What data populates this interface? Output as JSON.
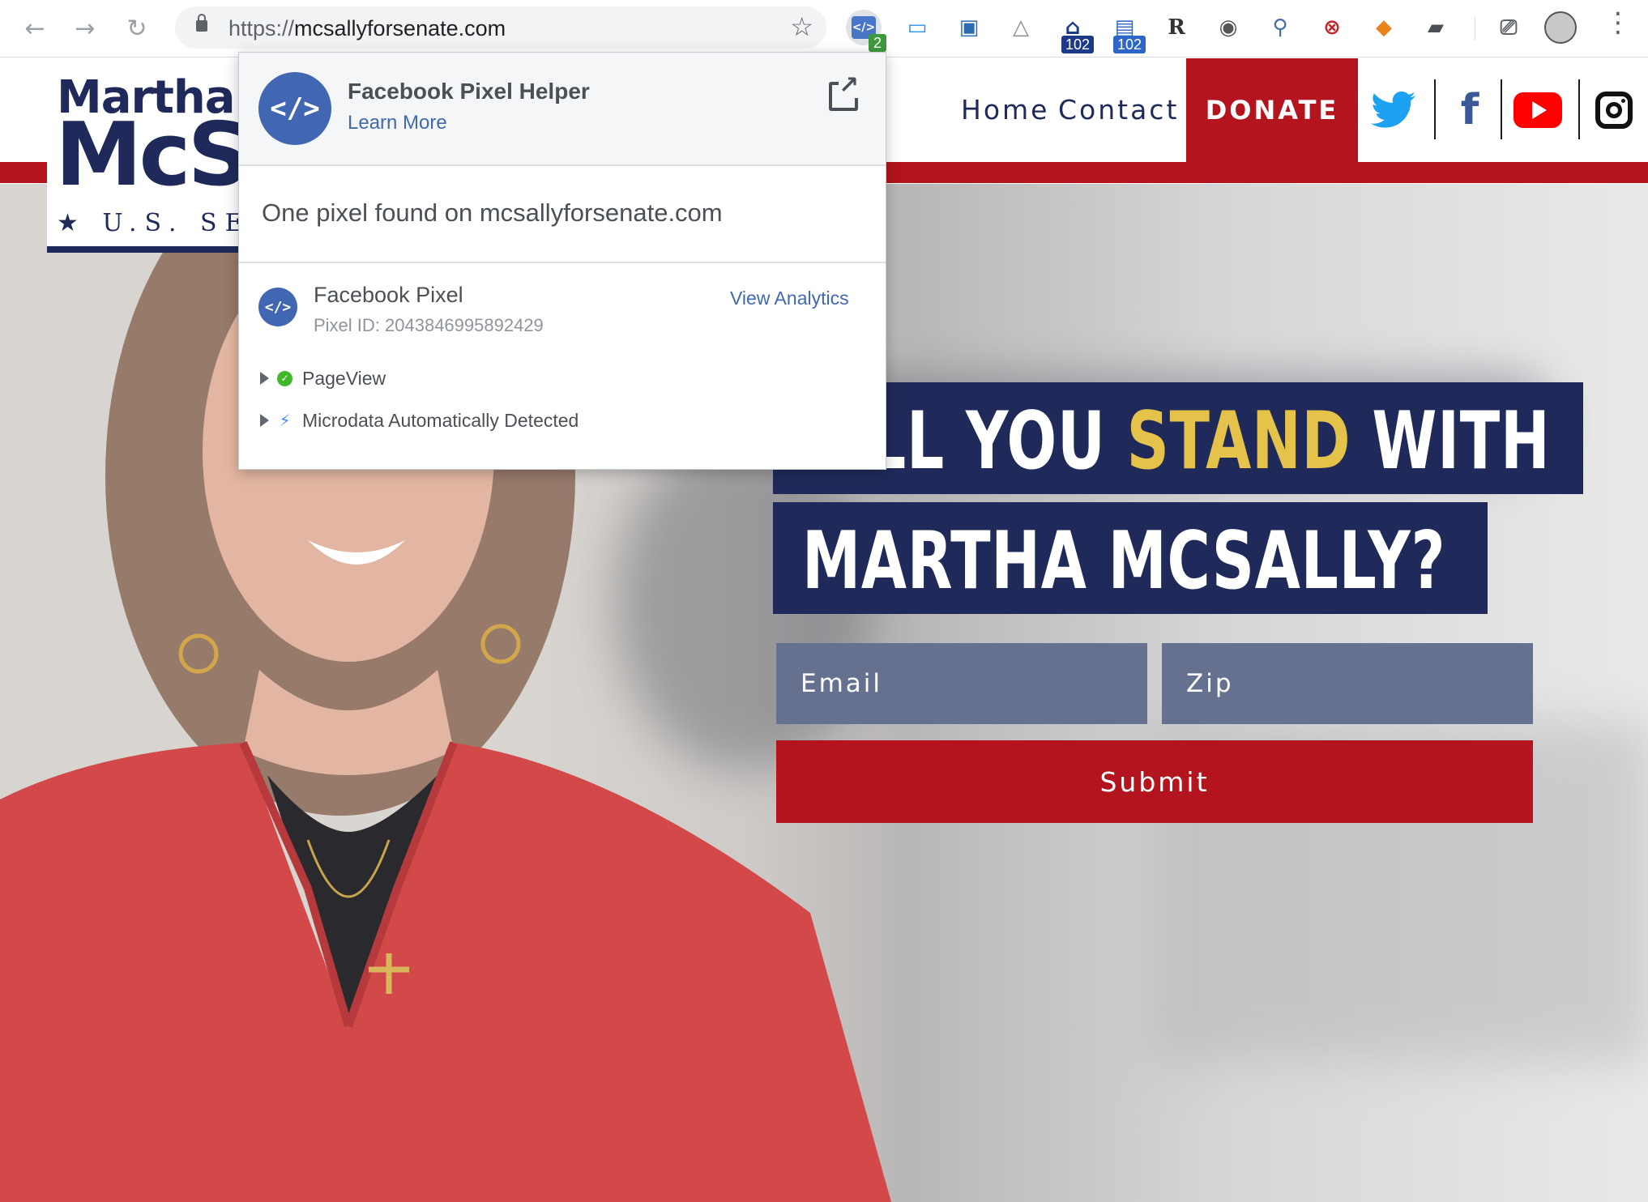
{
  "browser": {
    "url_scheme": "https://",
    "url_host": "mcsallyforsenate.com",
    "extensions": {
      "pixel_helper_badge": "2",
      "badge_a": "102",
      "badge_b": "102",
      "r_label": "R"
    }
  },
  "site": {
    "logo": {
      "first_name": "Martha",
      "last_name_visible": "McSA",
      "subtitle_visible": "★ U.S. SE"
    },
    "nav": {
      "home": "Home",
      "contact": "Contact",
      "donate": "DONATE"
    },
    "headline": {
      "line1_start": "LL YOU ",
      "line1_highlight": "STAND",
      "line1_end": " WITH",
      "line2": "MARTHA MCSALLY?"
    },
    "form": {
      "email_placeholder": "Email",
      "zip_placeholder": "Zip",
      "submit_label": "Submit"
    },
    "colors": {
      "navy": "#1f2a5a",
      "red": "#b3141d",
      "gold": "#e5c24a"
    }
  },
  "popup": {
    "title": "Facebook Pixel Helper",
    "learn_more": "Learn More",
    "found_text": "One pixel found on mcsallyforsenate.com",
    "pixel": {
      "name": "Facebook Pixel",
      "id_text": "Pixel ID: 2043846995892429",
      "view_analytics": "View Analytics"
    },
    "events": [
      {
        "label": "PageView",
        "status": "success"
      },
      {
        "label": "Microdata Automatically Detected",
        "status": "info"
      }
    ]
  }
}
